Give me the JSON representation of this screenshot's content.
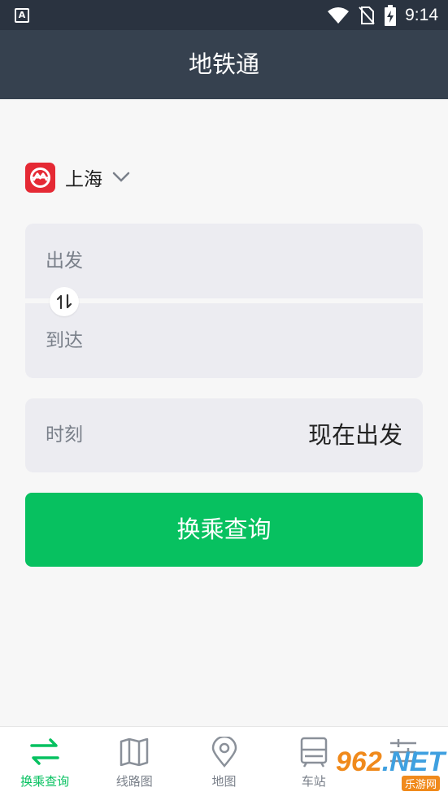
{
  "status_bar": {
    "app_badge": "A",
    "time": "9:14",
    "icons": [
      "wifi-icon",
      "no-sim-icon",
      "battery-charging-icon"
    ]
  },
  "app_bar": {
    "title": "地铁通"
  },
  "city_selector": {
    "logo_icon": "shanghai-metro-logo-icon",
    "name": "上海",
    "chevron_icon": "chevron-down-icon"
  },
  "route": {
    "from_placeholder": "出发",
    "to_placeholder": "到达",
    "swap_icon": "swap-vertical-icon"
  },
  "time": {
    "label": "时刻",
    "value": "现在出发"
  },
  "search_button": {
    "label": "换乘查询"
  },
  "tabs": [
    {
      "label": "换乘查询",
      "icon": "transfer-icon",
      "active": true
    },
    {
      "label": "线路图",
      "icon": "map-fold-icon",
      "active": false
    },
    {
      "label": "地图",
      "icon": "location-pin-icon",
      "active": false
    },
    {
      "label": "车站",
      "icon": "station-icon",
      "active": false
    },
    {
      "label": "",
      "icon": "settings-sliders-icon",
      "active": false
    }
  ],
  "watermark": {
    "top": "962.NET",
    "bottom": "乐游网"
  },
  "colors": {
    "status_bar": "#2a3340",
    "app_bar": "#36414f",
    "accent_green": "#07c160",
    "metro_red": "#e52934",
    "input_bg": "#ececf1",
    "placeholder": "#7a808a"
  }
}
